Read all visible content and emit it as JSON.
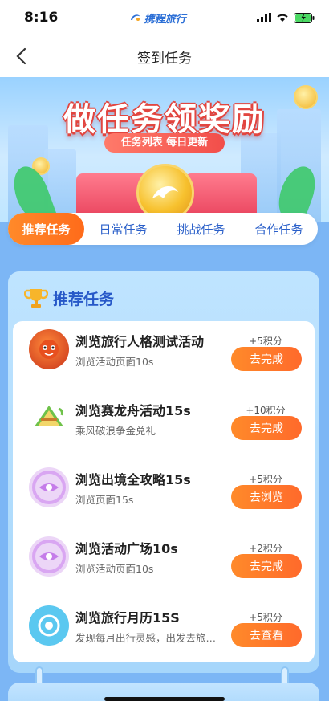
{
  "status_bar": {
    "time": "8:16",
    "app_name": "携程旅行"
  },
  "nav": {
    "title": "签到任务"
  },
  "banner": {
    "title": "做任务领奖励",
    "subtitle": "任务列表 每日更新"
  },
  "tabs": [
    {
      "label": "推荐任务",
      "active": true
    },
    {
      "label": "日常任务",
      "active": false
    },
    {
      "label": "挑战任务",
      "active": false
    },
    {
      "label": "合作任务",
      "active": false
    }
  ],
  "section": {
    "title": "推荐任务",
    "tasks": [
      {
        "title": "浏览旅行人格测试活动",
        "desc": "浏览活动页面10s",
        "points": "+5积分",
        "button": "去完成",
        "icon": "mascot-icon"
      },
      {
        "title": "浏览赛龙舟活动15s",
        "desc": "乘风破浪争金兑礼",
        "points": "+10积分",
        "button": "去完成",
        "icon": "zongzi-icon"
      },
      {
        "title": "浏览出境全攻略15s",
        "desc": "浏览页面15s",
        "points": "+5积分",
        "button": "去浏览",
        "icon": "eye-icon"
      },
      {
        "title": "浏览活动广场10s",
        "desc": "浏览活动页面10s",
        "points": "+2积分",
        "button": "去完成",
        "icon": "eye-icon"
      },
      {
        "title": "浏览旅行月历15S",
        "desc": "发现每月出行灵感，出发去旅…",
        "points": "+5积分",
        "button": "去查看",
        "icon": "target-icon"
      }
    ]
  },
  "colors": {
    "accent": "#ff6b1a",
    "primary": "#2658c8",
    "background": "#7cb6f5"
  }
}
